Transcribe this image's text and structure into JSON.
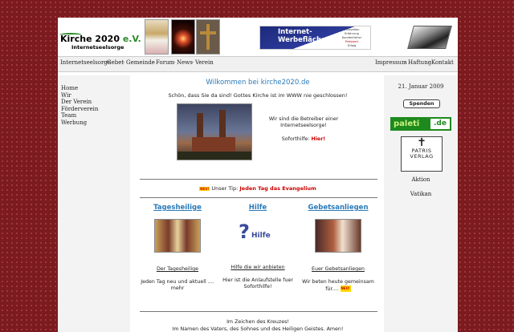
{
  "header": {
    "logo_title_a": "Kirche 2020 ",
    "logo_title_b": "e.V.",
    "logo_subtitle": "Internetseelsorge",
    "banner_title": "Internet-\nWerbefläche??",
    "banner_lines": [
      "Innovation",
      "Erfahrung",
      "Kundenfreher",
      "Preiswert",
      "Erfolg"
    ]
  },
  "navbar": {
    "left": [
      "Internetseelsorge",
      "Gebet",
      "Gemeinde",
      "Forum",
      "News",
      "Verein"
    ],
    "right": [
      "Impressum",
      "Haftung",
      "Kontakt"
    ],
    "separator": "·"
  },
  "sidebar_left": {
    "items": [
      "Home",
      "Wir",
      "Der Verein",
      "Förderverein",
      "Team",
      "Werbung"
    ]
  },
  "main": {
    "welcome": "Wilkommen bei kirche2020.de",
    "intro": "Schön, dass Sie da sind! Gottes Kirche ist im WWW nie geschlossen!",
    "betreiber": "Wir sind die Betreiber einer Internetseelsorge!",
    "soforthilfe_label": "Soforthilfe:",
    "soforthilfe_link": "Hier!",
    "neu_badge": "NEU!",
    "tip_label": "Unser Tip:",
    "tip_link": "Jeden Tag das Evangelium",
    "columns": [
      {
        "heading": "Tagesheilige",
        "sub": "Der Tagesheilige",
        "desc": "Jeden Tag neu und aktuell .... mehr"
      },
      {
        "heading": "Hilfe",
        "sub": "Hilfe die wir anbieten",
        "desc": "Hier ist die Anlaufstelle fuer Soforthilfe!",
        "image_text": "Hilfe"
      },
      {
        "heading": "Gebetsanliegen",
        "sub": "Euer Gebetsanliegen",
        "desc": "Wir beten heute gemeinsam für....",
        "badge": "NEU!"
      }
    ],
    "footer_line1": "Im Zeichen des Kreuzes!",
    "footer_line2": "Im Namen des Vaters, des Sohnes und des Heiligen Geistes. Amen!"
  },
  "sidebar_right": {
    "date": "21. Januar 2009",
    "spenden": "Spenden",
    "paleti_left": "paleti",
    "paleti_right": ".de",
    "patris_line1": "PATRIS",
    "patris_line2": "VERLAG",
    "aktion": "Aktion",
    "vatikan": "Vatikan"
  }
}
